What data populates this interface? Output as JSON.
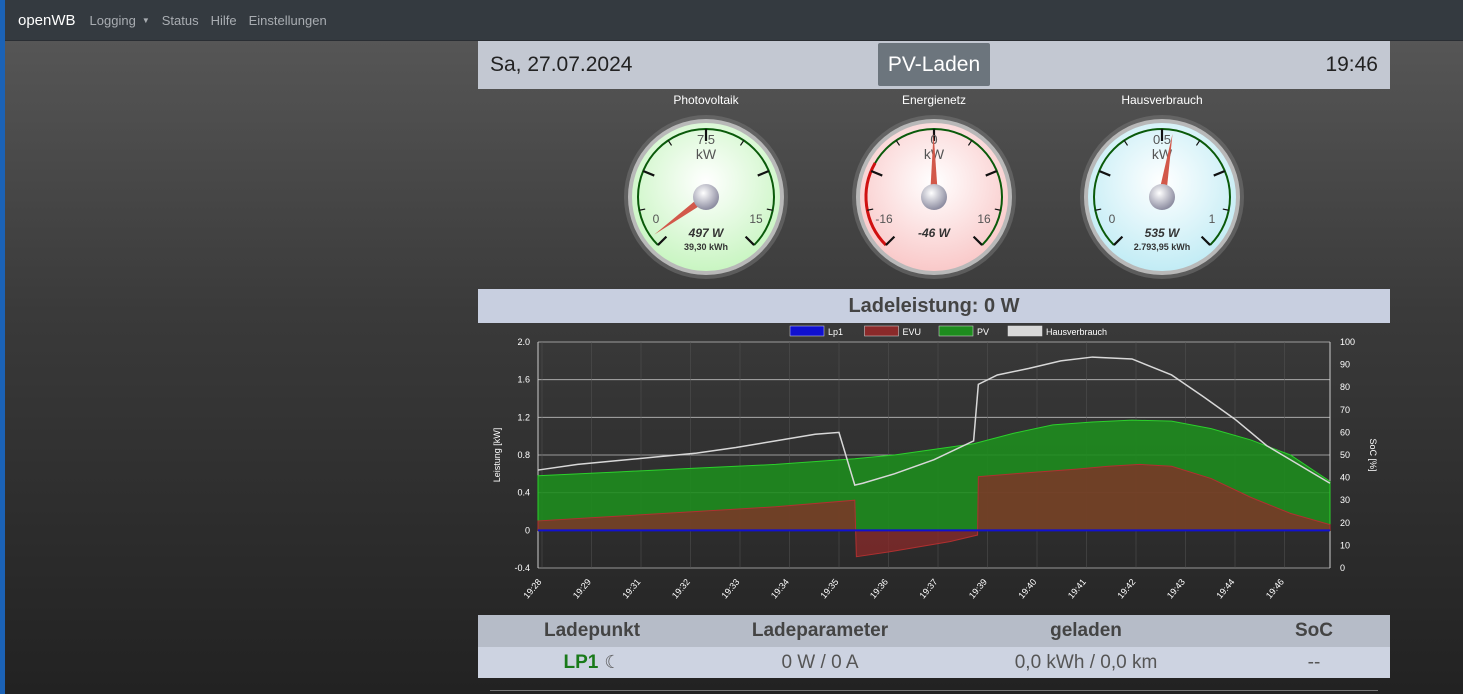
{
  "navbar": {
    "brand": "openWB",
    "items": [
      {
        "label": "Logging",
        "dropdown": true
      },
      {
        "label": "Status"
      },
      {
        "label": "Hilfe"
      },
      {
        "label": "Einstellungen"
      }
    ]
  },
  "header": {
    "date": "Sa, 27.07.2024",
    "mode": "PV-Laden",
    "time": "19:46"
  },
  "gauges": [
    {
      "title": "Photovoltaik",
      "unit": "kW",
      "min": 0,
      "mid": 7.5,
      "max": 15,
      "min_label": "0",
      "mid_label": "7.5",
      "max_label": "15",
      "value": 0.497,
      "value_label": "497 W",
      "energy_label": "39,30 kWh",
      "color": "#c9f5c2"
    },
    {
      "title": "Energienetz",
      "unit": "kW",
      "min": -16,
      "mid": 0,
      "max": 16,
      "min_label": "-16",
      "mid_label": "0",
      "max_label": "16",
      "value": -0.046,
      "value_label": "-46 W",
      "energy_label": "",
      "color": "#f9c9c9"
    },
    {
      "title": "Hausverbrauch",
      "unit": "kW",
      "min": 0,
      "mid": 0.5,
      "max": 1,
      "min_label": "0",
      "mid_label": "0.5",
      "max_label": "1",
      "value": 0.535,
      "value_label": "535 W",
      "energy_label": "2.793,95 kWh",
      "color": "#c2ecf5"
    }
  ],
  "ladeleistung": "Ladeleistung: 0 W",
  "chart_data": {
    "type": "line",
    "ylabel": "Leistung [kW]",
    "y2label": "SoC [%]",
    "ylim": [
      -0.4,
      2.0
    ],
    "yticks": [
      "2.0",
      "1.6",
      "1.2",
      "0.8",
      "0.4",
      "0",
      "-0.4"
    ],
    "y2lim": [
      0,
      100
    ],
    "y2ticks": [
      "100",
      "90",
      "80",
      "70",
      "60",
      "50",
      "40",
      "30",
      "20",
      "10",
      "0"
    ],
    "xticks": [
      "19:28",
      "19:29",
      "19:31",
      "19:32",
      "19:33",
      "19:34",
      "19:35",
      "19:36",
      "19:37",
      "19:39",
      "19:40",
      "19:41",
      "19:42",
      "19:43",
      "19:44",
      "19:46"
    ],
    "legend_position": "top",
    "series": [
      {
        "name": "Lp1",
        "color": "#1010d0",
        "x": [
          0,
          100
        ],
        "values": [
          0,
          0
        ]
      },
      {
        "name": "EVU",
        "color": "#8b2a2a",
        "x": [
          0,
          8,
          20,
          30,
          40,
          40.2,
          45,
          52,
          55.5,
          55.6,
          60,
          68,
          72,
          76,
          80,
          85,
          90,
          95,
          100
        ],
        "values": [
          0.1,
          0.14,
          0.2,
          0.25,
          0.32,
          -0.28,
          -0.22,
          -0.12,
          -0.05,
          0.57,
          0.6,
          0.65,
          0.68,
          0.7,
          0.68,
          0.55,
          0.35,
          0.18,
          0.06
        ]
      },
      {
        "name": "PV",
        "color": "#1e8c1e",
        "x": [
          0,
          10,
          20,
          30,
          40,
          45,
          55,
          60,
          65,
          70,
          75,
          80,
          85,
          90,
          95,
          100
        ],
        "values": [
          0.58,
          0.62,
          0.66,
          0.7,
          0.76,
          0.8,
          0.92,
          1.03,
          1.12,
          1.15,
          1.17,
          1.16,
          1.08,
          0.96,
          0.8,
          0.52
        ]
      },
      {
        "name": "Hausverbrauch",
        "color": "#d8d8d8",
        "x": [
          0,
          5,
          10,
          15,
          20,
          25,
          30,
          35,
          38,
          40,
          41,
          45,
          50,
          55,
          55.6,
          58,
          62,
          66,
          70,
          75,
          80,
          84,
          88,
          92,
          95,
          98,
          100
        ],
        "values": [
          0.64,
          0.7,
          0.74,
          0.78,
          0.82,
          0.88,
          0.95,
          1.02,
          1.04,
          0.48,
          0.5,
          0.6,
          0.75,
          0.95,
          1.55,
          1.65,
          1.72,
          1.8,
          1.84,
          1.82,
          1.65,
          1.42,
          1.18,
          0.9,
          0.75,
          0.6,
          0.5
        ]
      }
    ]
  },
  "table": {
    "headers": [
      "Ladepunkt",
      "Ladeparameter",
      "geladen",
      "SoC"
    ],
    "row": {
      "name": "LP1",
      "moon_icon": "☾",
      "params": "0 W / 0 A",
      "charged": "0,0 kWh / 0,0 km",
      "soc": "--"
    }
  }
}
